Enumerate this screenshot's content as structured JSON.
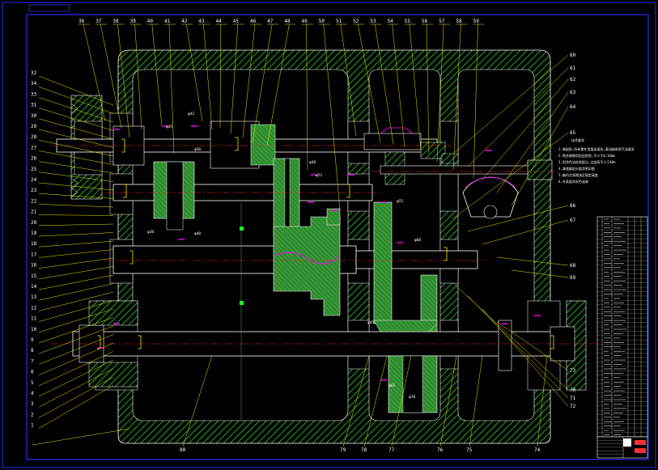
{
  "drawing": {
    "colors": {
      "background": "#000000",
      "frame": "#2b2bff",
      "housing_hatch": "#1fa81f",
      "gear_fill": "#2e8b2e",
      "outline": "#ffffff",
      "leader": "#e8e800",
      "centerline": "#ff2020",
      "dim_mark": "#ff00ff",
      "seal": "#ffe000"
    },
    "top_labels": [
      "36",
      "37",
      "38",
      "39",
      "40",
      "41",
      "42",
      "43",
      "44",
      "45",
      "46",
      "47",
      "48",
      "49",
      "50",
      "51",
      "52",
      "53",
      "54",
      "55",
      "56",
      "57",
      "58",
      "59"
    ],
    "left_labels": [
      "32",
      "34",
      "33",
      "31",
      "30",
      "29",
      "28",
      "27",
      "26",
      "25",
      "24",
      "23",
      "22",
      "21",
      "20",
      "19",
      "18",
      "17",
      "16",
      "15",
      "14",
      "13",
      "12",
      "11",
      "10",
      "9",
      "8",
      "7",
      "6",
      "5",
      "4",
      "3",
      "2",
      "1"
    ],
    "right_labels": [
      "60",
      "61",
      "62",
      "63",
      "64",
      "65",
      "66",
      "67",
      "68",
      "69",
      "70",
      "71",
      "72",
      "73"
    ],
    "bottom_labels": [
      "80",
      "79",
      "78",
      "77",
      "76",
      "75",
      "74"
    ],
    "size_tags": [
      "φ42",
      "φ45",
      "φ48",
      "φ52",
      "φ40",
      "φ38",
      "φ55",
      "φ60",
      "φ65",
      "φ70",
      "φ45",
      "φ50"
    ],
    "tech_requirements": {
      "title": "技术要求",
      "lines": [
        "1.装配前,所有零件用煤油清洗,滚动轴承用汽油清洗",
        "2.啮合侧隙用铅丝检验,不小于0.16mm",
        "3.用涂色法检验斑点,沿齿高不小于40%",
        "4.减速器剖分面涂密封胶",
        "5.箱内注润滑油至规定高度",
        "6.外表面涂灰色油漆"
      ]
    },
    "bom_rows": 50,
    "title_block_rows": 6
  }
}
